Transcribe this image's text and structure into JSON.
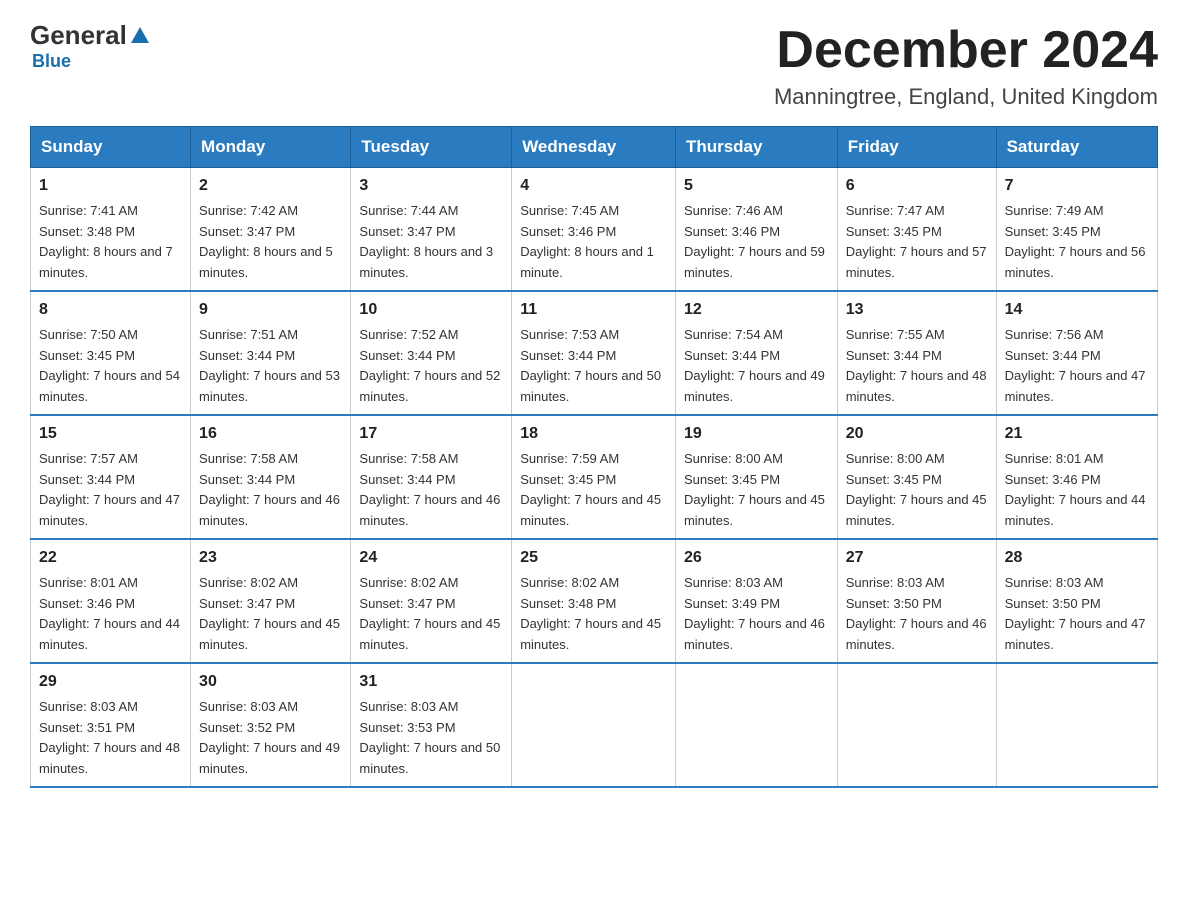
{
  "logo": {
    "general": "General",
    "blue": "Blue",
    "underline": "Blue"
  },
  "header": {
    "title": "December 2024",
    "location": "Manningtree, England, United Kingdom"
  },
  "weekdays": [
    "Sunday",
    "Monday",
    "Tuesday",
    "Wednesday",
    "Thursday",
    "Friday",
    "Saturday"
  ],
  "weeks": [
    [
      {
        "day": "1",
        "sunrise": "Sunrise: 7:41 AM",
        "sunset": "Sunset: 3:48 PM",
        "daylight": "Daylight: 8 hours and 7 minutes."
      },
      {
        "day": "2",
        "sunrise": "Sunrise: 7:42 AM",
        "sunset": "Sunset: 3:47 PM",
        "daylight": "Daylight: 8 hours and 5 minutes."
      },
      {
        "day": "3",
        "sunrise": "Sunrise: 7:44 AM",
        "sunset": "Sunset: 3:47 PM",
        "daylight": "Daylight: 8 hours and 3 minutes."
      },
      {
        "day": "4",
        "sunrise": "Sunrise: 7:45 AM",
        "sunset": "Sunset: 3:46 PM",
        "daylight": "Daylight: 8 hours and 1 minute."
      },
      {
        "day": "5",
        "sunrise": "Sunrise: 7:46 AM",
        "sunset": "Sunset: 3:46 PM",
        "daylight": "Daylight: 7 hours and 59 minutes."
      },
      {
        "day": "6",
        "sunrise": "Sunrise: 7:47 AM",
        "sunset": "Sunset: 3:45 PM",
        "daylight": "Daylight: 7 hours and 57 minutes."
      },
      {
        "day": "7",
        "sunrise": "Sunrise: 7:49 AM",
        "sunset": "Sunset: 3:45 PM",
        "daylight": "Daylight: 7 hours and 56 minutes."
      }
    ],
    [
      {
        "day": "8",
        "sunrise": "Sunrise: 7:50 AM",
        "sunset": "Sunset: 3:45 PM",
        "daylight": "Daylight: 7 hours and 54 minutes."
      },
      {
        "day": "9",
        "sunrise": "Sunrise: 7:51 AM",
        "sunset": "Sunset: 3:44 PM",
        "daylight": "Daylight: 7 hours and 53 minutes."
      },
      {
        "day": "10",
        "sunrise": "Sunrise: 7:52 AM",
        "sunset": "Sunset: 3:44 PM",
        "daylight": "Daylight: 7 hours and 52 minutes."
      },
      {
        "day": "11",
        "sunrise": "Sunrise: 7:53 AM",
        "sunset": "Sunset: 3:44 PM",
        "daylight": "Daylight: 7 hours and 50 minutes."
      },
      {
        "day": "12",
        "sunrise": "Sunrise: 7:54 AM",
        "sunset": "Sunset: 3:44 PM",
        "daylight": "Daylight: 7 hours and 49 minutes."
      },
      {
        "day": "13",
        "sunrise": "Sunrise: 7:55 AM",
        "sunset": "Sunset: 3:44 PM",
        "daylight": "Daylight: 7 hours and 48 minutes."
      },
      {
        "day": "14",
        "sunrise": "Sunrise: 7:56 AM",
        "sunset": "Sunset: 3:44 PM",
        "daylight": "Daylight: 7 hours and 47 minutes."
      }
    ],
    [
      {
        "day": "15",
        "sunrise": "Sunrise: 7:57 AM",
        "sunset": "Sunset: 3:44 PM",
        "daylight": "Daylight: 7 hours and 47 minutes."
      },
      {
        "day": "16",
        "sunrise": "Sunrise: 7:58 AM",
        "sunset": "Sunset: 3:44 PM",
        "daylight": "Daylight: 7 hours and 46 minutes."
      },
      {
        "day": "17",
        "sunrise": "Sunrise: 7:58 AM",
        "sunset": "Sunset: 3:44 PM",
        "daylight": "Daylight: 7 hours and 46 minutes."
      },
      {
        "day": "18",
        "sunrise": "Sunrise: 7:59 AM",
        "sunset": "Sunset: 3:45 PM",
        "daylight": "Daylight: 7 hours and 45 minutes."
      },
      {
        "day": "19",
        "sunrise": "Sunrise: 8:00 AM",
        "sunset": "Sunset: 3:45 PM",
        "daylight": "Daylight: 7 hours and 45 minutes."
      },
      {
        "day": "20",
        "sunrise": "Sunrise: 8:00 AM",
        "sunset": "Sunset: 3:45 PM",
        "daylight": "Daylight: 7 hours and 45 minutes."
      },
      {
        "day": "21",
        "sunrise": "Sunrise: 8:01 AM",
        "sunset": "Sunset: 3:46 PM",
        "daylight": "Daylight: 7 hours and 44 minutes."
      }
    ],
    [
      {
        "day": "22",
        "sunrise": "Sunrise: 8:01 AM",
        "sunset": "Sunset: 3:46 PM",
        "daylight": "Daylight: 7 hours and 44 minutes."
      },
      {
        "day": "23",
        "sunrise": "Sunrise: 8:02 AM",
        "sunset": "Sunset: 3:47 PM",
        "daylight": "Daylight: 7 hours and 45 minutes."
      },
      {
        "day": "24",
        "sunrise": "Sunrise: 8:02 AM",
        "sunset": "Sunset: 3:47 PM",
        "daylight": "Daylight: 7 hours and 45 minutes."
      },
      {
        "day": "25",
        "sunrise": "Sunrise: 8:02 AM",
        "sunset": "Sunset: 3:48 PM",
        "daylight": "Daylight: 7 hours and 45 minutes."
      },
      {
        "day": "26",
        "sunrise": "Sunrise: 8:03 AM",
        "sunset": "Sunset: 3:49 PM",
        "daylight": "Daylight: 7 hours and 46 minutes."
      },
      {
        "day": "27",
        "sunrise": "Sunrise: 8:03 AM",
        "sunset": "Sunset: 3:50 PM",
        "daylight": "Daylight: 7 hours and 46 minutes."
      },
      {
        "day": "28",
        "sunrise": "Sunrise: 8:03 AM",
        "sunset": "Sunset: 3:50 PM",
        "daylight": "Daylight: 7 hours and 47 minutes."
      }
    ],
    [
      {
        "day": "29",
        "sunrise": "Sunrise: 8:03 AM",
        "sunset": "Sunset: 3:51 PM",
        "daylight": "Daylight: 7 hours and 48 minutes."
      },
      {
        "day": "30",
        "sunrise": "Sunrise: 8:03 AM",
        "sunset": "Sunset: 3:52 PM",
        "daylight": "Daylight: 7 hours and 49 minutes."
      },
      {
        "day": "31",
        "sunrise": "Sunrise: 8:03 AM",
        "sunset": "Sunset: 3:53 PM",
        "daylight": "Daylight: 7 hours and 50 minutes."
      },
      null,
      null,
      null,
      null
    ]
  ]
}
